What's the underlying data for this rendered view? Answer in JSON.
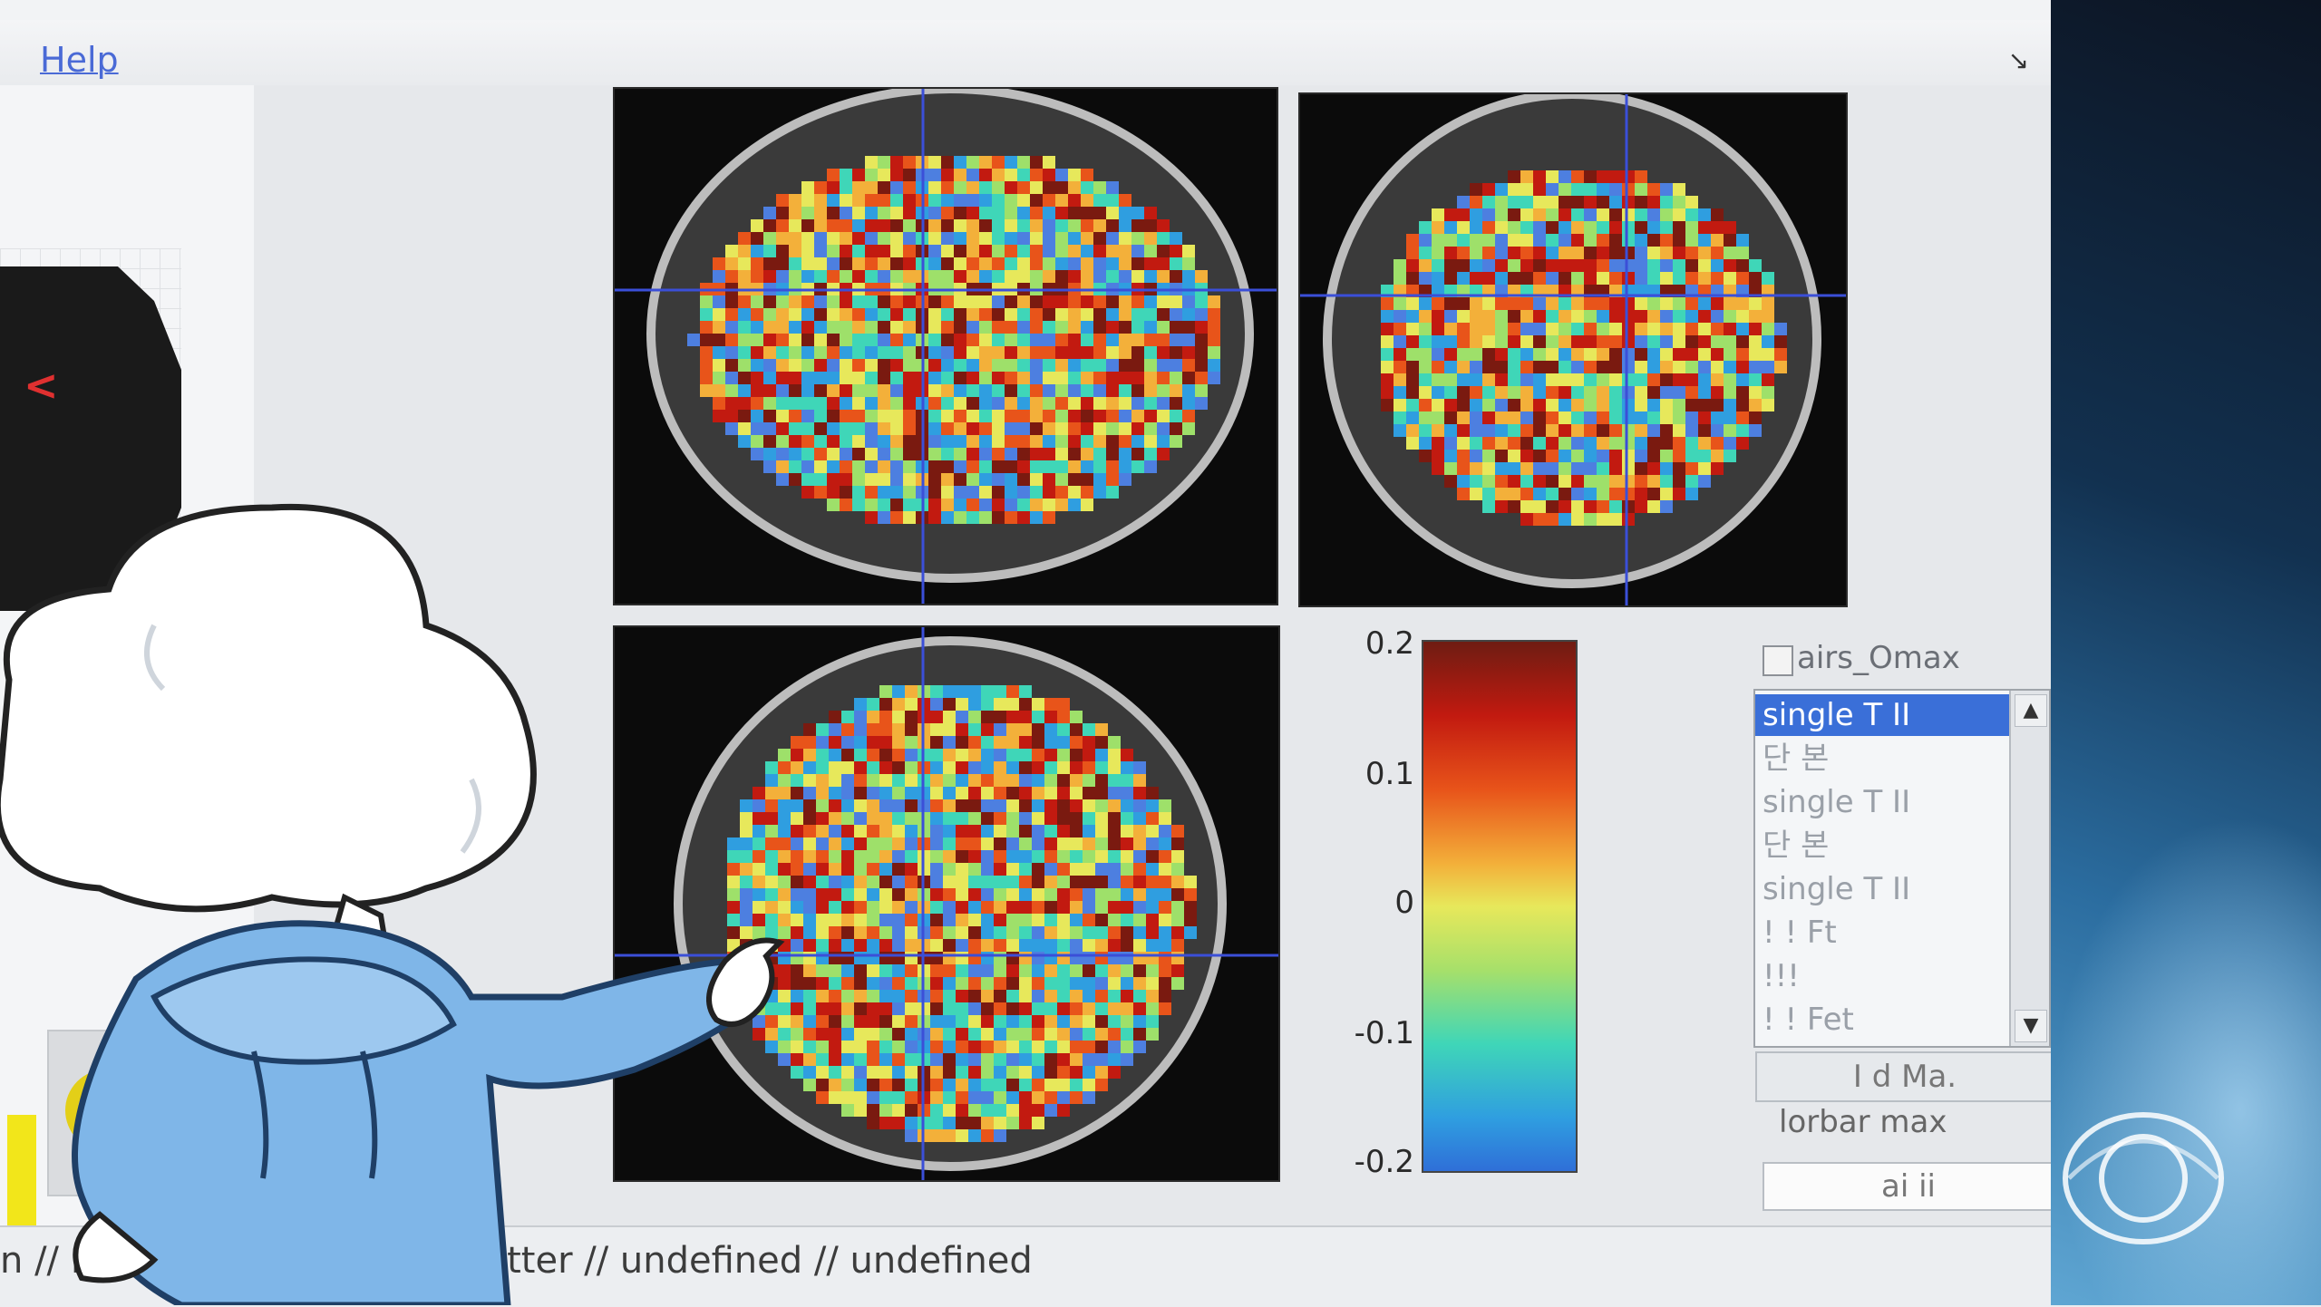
{
  "menu": {
    "help_label": "Help",
    "corner_icon": "resize-arrow-icon",
    "corner_glyph": "↘"
  },
  "thumbnail": {
    "marker": "<"
  },
  "colorbar": {
    "ticks": [
      "0.2",
      "0.1",
      "0",
      "-0.1",
      "-0.2"
    ]
  },
  "controls": {
    "checkbox_label": "airs_Omax",
    "list_items": [
      {
        "label": "single T II",
        "selected": true
      },
      {
        "label": "단  본",
        "selected": false
      },
      {
        "label": "single T II",
        "selected": false
      },
      {
        "label": "단  본",
        "selected": false
      },
      {
        "label": "single T II",
        "selected": false
      },
      {
        "label": "!  !  Ft",
        "selected": false
      },
      {
        "label": "!!!",
        "selected": false
      },
      {
        "label": "!  !  Fet",
        "selected": false
      }
    ],
    "button_1_label": "I  d  Ma.",
    "colorbar_max_label": "lorbar max",
    "button_3_label": "ai  ii",
    "scroll_up_glyph": "▲",
    "scroll_down_glyph": "▼"
  },
  "status": {
    "text": "n // Li                    ate Gyrus // White Matter // undefined // undefined"
  },
  "colors": {
    "selection": "#3a6fd8",
    "crosshair": "#3b4fd8",
    "accent_link": "#4a6ad6"
  }
}
